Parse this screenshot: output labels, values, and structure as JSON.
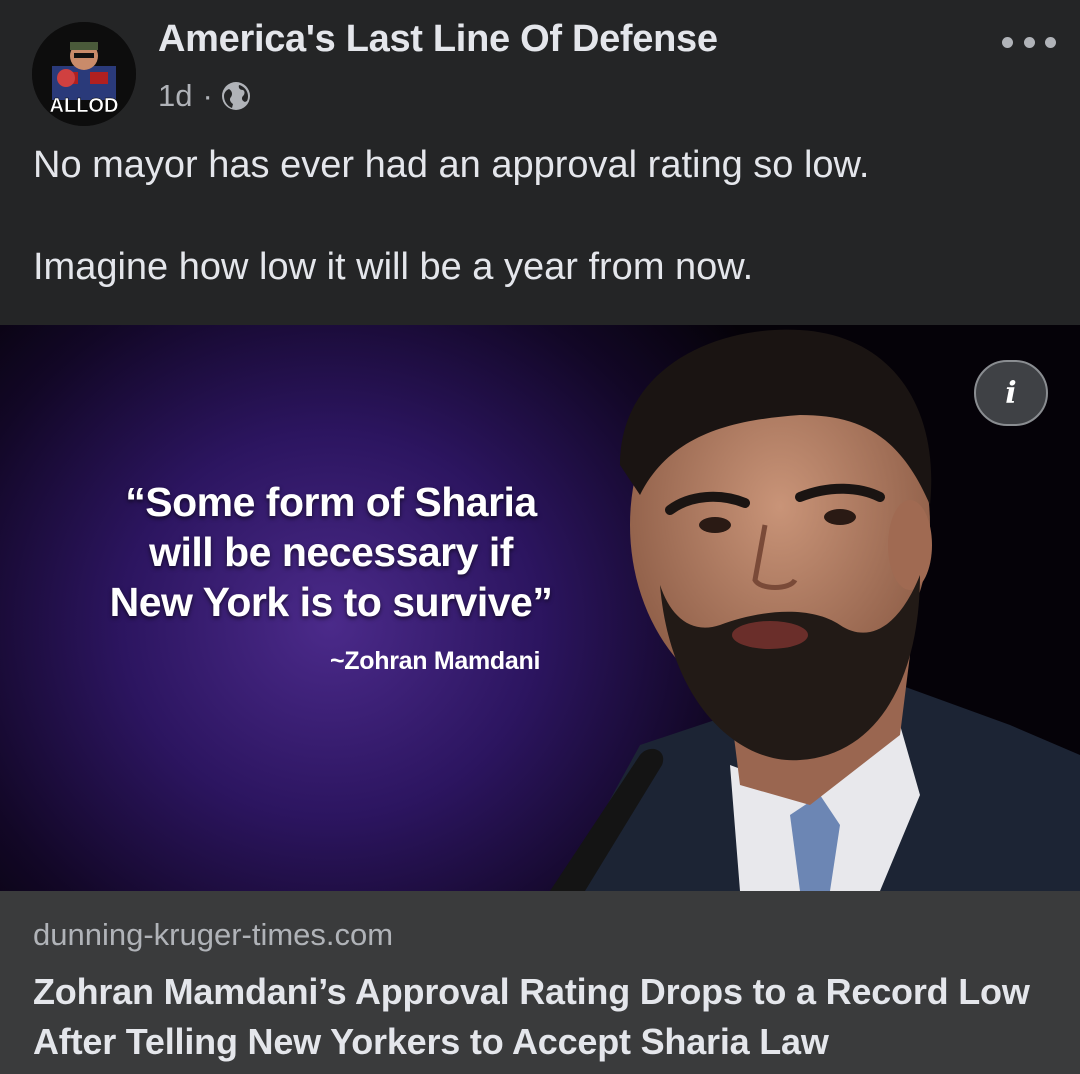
{
  "post": {
    "page_name": "America's Last Line Of Defense",
    "avatar_text": "ALLOD",
    "time_ago": "1d",
    "separator": "·",
    "audience_icon": "globe-icon",
    "more_icon": "more-options-icon",
    "text_lines": [
      "No mayor has ever had an approval rating so low.",
      "Imagine how low it will be a year from now."
    ]
  },
  "image": {
    "quote_lines": [
      "“Some form of Sharia",
      "will be necessary if",
      "New York is to survive”"
    ],
    "attribution": "~Zohran Mamdani",
    "info_icon": "info-icon",
    "info_glyph": "i"
  },
  "link_preview": {
    "domain": "dunning-kruger-times.com",
    "headline_lines": [
      "Zohran Mamdani’s Approval Rating Drops to a Record Low",
      "After Telling New Yorkers to Accept Sharia Law"
    ]
  },
  "colors": {
    "background": "#242526",
    "link_preview_bg": "#3a3b3c",
    "primary_text": "#e4e6eb",
    "secondary_text": "#b0b3b8",
    "image_glow": "#4b2a8a"
  }
}
